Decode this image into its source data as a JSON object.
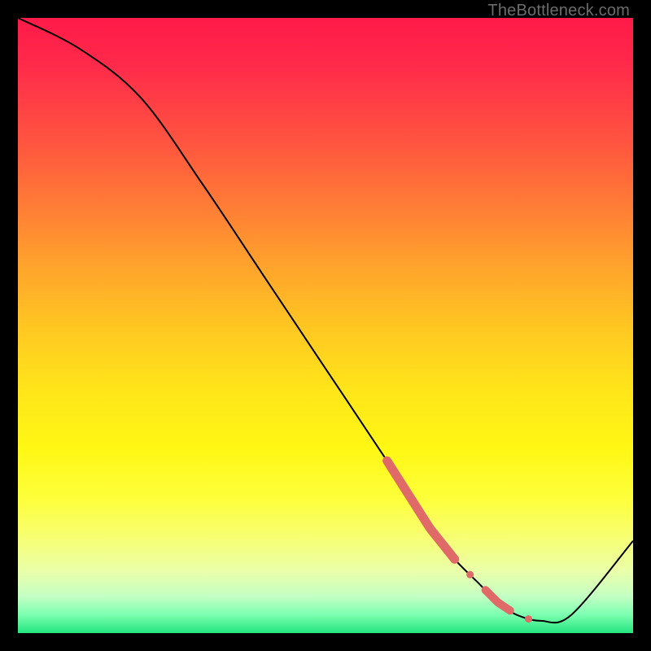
{
  "watermark": "TheBottleneck.com",
  "chart_data": {
    "type": "line",
    "title": "",
    "xlabel": "",
    "ylabel": "",
    "xlim": [
      0,
      100
    ],
    "ylim": [
      0,
      100
    ],
    "series": [
      {
        "name": "curve",
        "x": [
          0,
          10,
          20,
          30,
          40,
          50,
          60,
          67,
          71,
          75,
          78,
          81,
          85,
          90,
          100
        ],
        "y": [
          100,
          95,
          87,
          73,
          58,
          43,
          28,
          17,
          12,
          8,
          5,
          3,
          2,
          3,
          15
        ],
        "color": "#000000",
        "width": 2
      }
    ],
    "markers": [
      {
        "name": "thick-segment",
        "x_from": 60,
        "x_to": 71,
        "color": "#e06a67",
        "width": 11
      },
      {
        "name": "dot-a",
        "x": 73.5,
        "y": 9.5,
        "r": 4.5,
        "color": "#e06a67"
      },
      {
        "name": "dash-b",
        "x_from": 76,
        "x_to": 80,
        "color": "#e06a67",
        "width": 10
      },
      {
        "name": "dot-c",
        "x": 83,
        "y": 2.3,
        "r": 4.5,
        "color": "#e06a67"
      }
    ]
  }
}
